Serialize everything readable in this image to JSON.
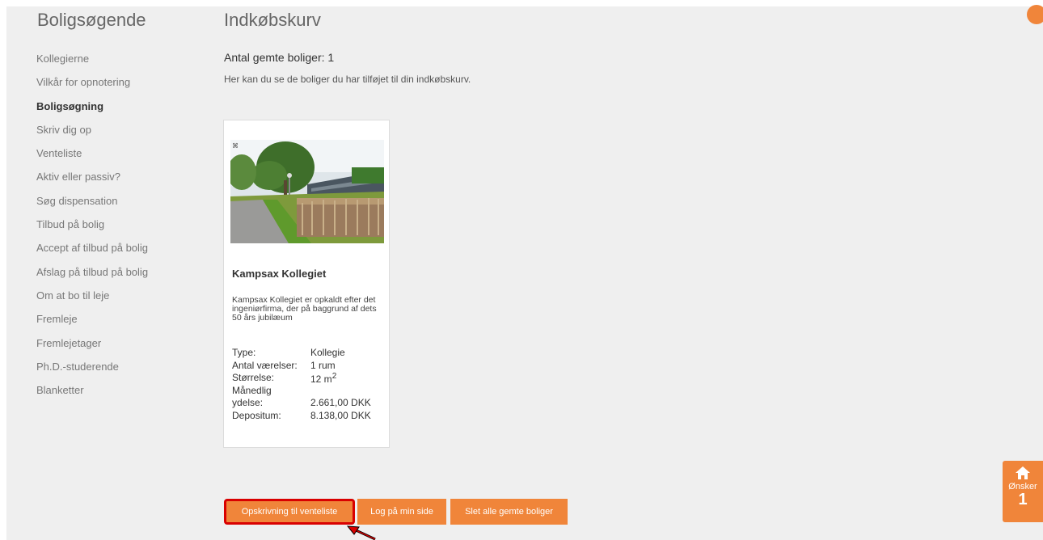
{
  "sidebar": {
    "title": "Boligsøgende",
    "items": [
      {
        "label": "Kollegierne"
      },
      {
        "label": "Vilkår for opnotering"
      },
      {
        "label": "Boligsøgning"
      },
      {
        "label": "Skriv dig op"
      },
      {
        "label": "Venteliste"
      },
      {
        "label": "Aktiv eller passiv?"
      },
      {
        "label": "Søg dispensation"
      },
      {
        "label": "Tilbud på bolig"
      },
      {
        "label": "Accept af tilbud på bolig"
      },
      {
        "label": "Afslag på tilbud på bolig"
      },
      {
        "label": "Om at bo til leje"
      },
      {
        "label": "Fremleje"
      },
      {
        "label": "Fremlejetager"
      },
      {
        "label": "Ph.D.-studerende"
      },
      {
        "label": "Blanketter"
      }
    ],
    "active_index": 2
  },
  "main": {
    "title": "Indkøbskurv",
    "count_label": "Antal gemte boliger: 1",
    "intro": "Her kan du se de boliger du har tilføjet til din indkøbskurv."
  },
  "card": {
    "title": "Kampsax Kollegiet",
    "description": "Kampsax Kollegiet er opkaldt efter det ingeniørfirma, der på baggrund af dets 50 års jubilæum",
    "specs": {
      "type_label": "Type:",
      "type_value": "Kollegie",
      "rooms_label": "Antal værelser:",
      "rooms_value": "1 rum",
      "size_label": "Størrelse:",
      "size_value": "12 m",
      "size_unit_sup": "2",
      "monthly_label_1": "Månedlig",
      "monthly_label_2": "ydelse:",
      "monthly_value": "2.661,00 DKK",
      "deposit_label": "Depositum:",
      "deposit_value": "8.138,00 DKK"
    }
  },
  "buttons": {
    "signup": "Opskrivning til venteliste",
    "login": "Log på min side",
    "delete_all": "Slet alle gemte boliger"
  },
  "wish_widget": {
    "label": "Ønsker",
    "count": "1"
  },
  "colors": {
    "accent": "#f0853a",
    "highlight": "#d90000",
    "page_bg": "#efefef"
  }
}
